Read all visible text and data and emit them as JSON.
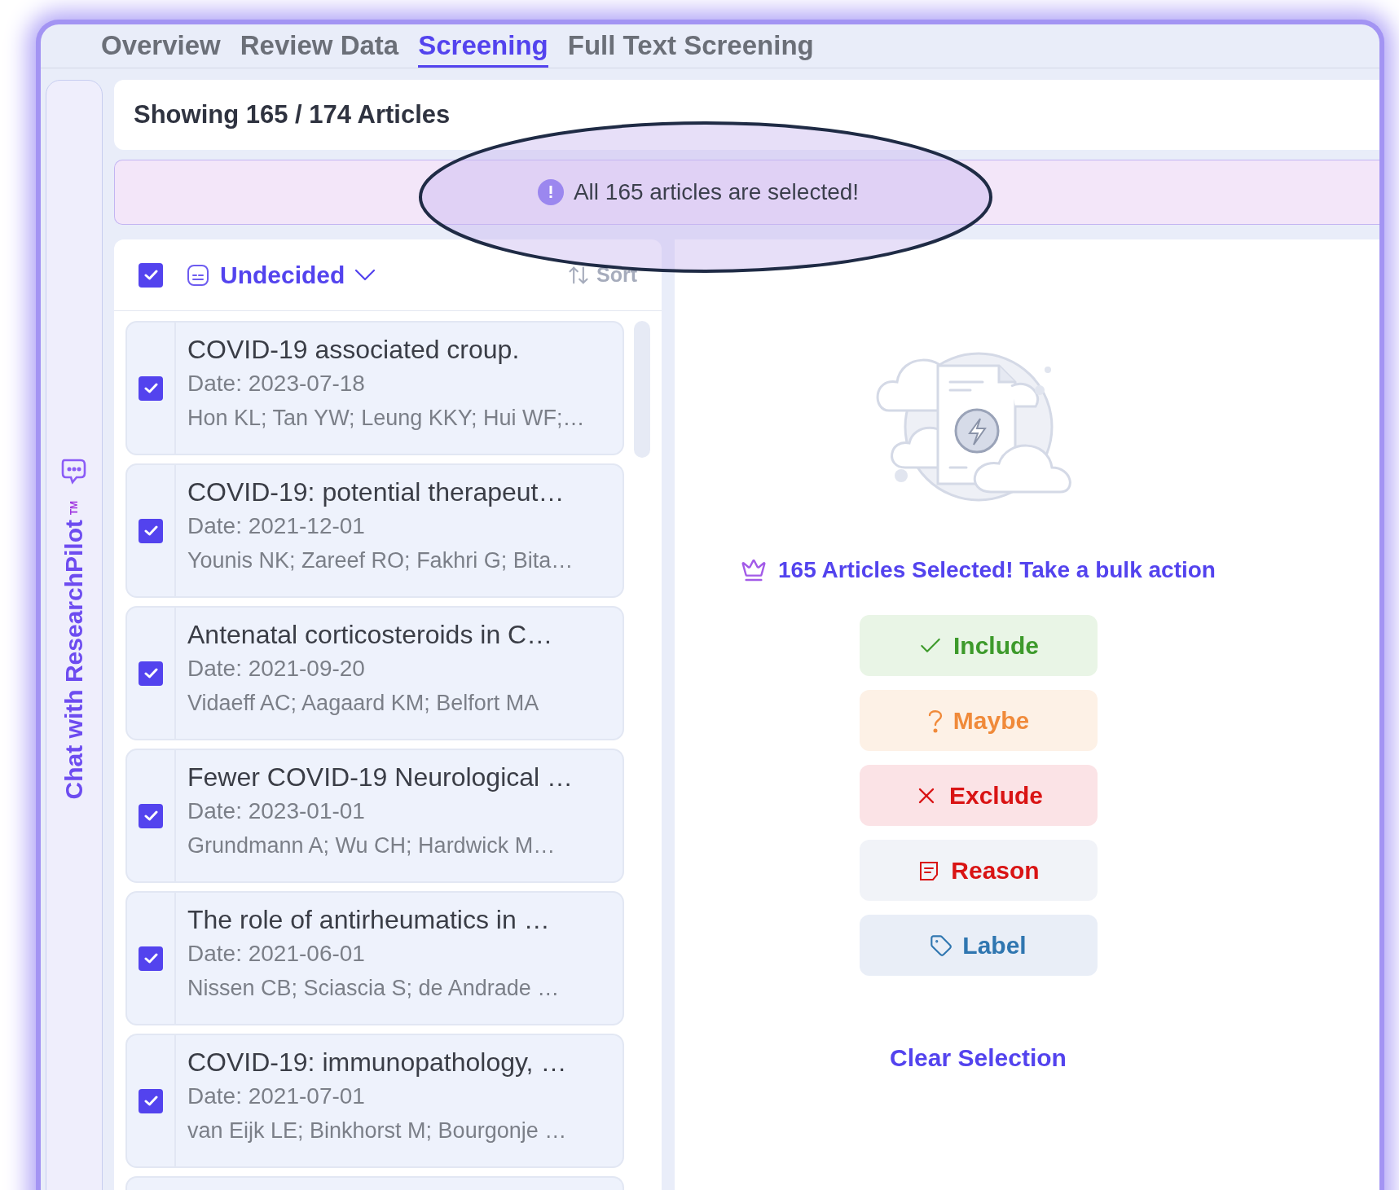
{
  "tabs": [
    {
      "label": "Overview",
      "selected": false
    },
    {
      "label": "Review Data",
      "selected": false
    },
    {
      "label": "Screening",
      "selected": true
    },
    {
      "label": "Full Text Screening",
      "selected": false
    }
  ],
  "sidebar": {
    "label": "Chat with ResearchPilot",
    "badge": "TM"
  },
  "header": {
    "title": "Showing 165 / 174 Articles"
  },
  "banner": {
    "message": "All 165 articles are selected!"
  },
  "list_header": {
    "select_all_checked": true,
    "filter": "Undecided",
    "sort": "Sort"
  },
  "articles": [
    {
      "checked": true,
      "title": "COVID-19 associated croup.",
      "date": "Date: 2023-07-18",
      "authors": "Hon KL; Tan YW; Leung KKY; Hui WF;…"
    },
    {
      "checked": true,
      "title": "COVID-19: potential therapeut…",
      "date": "Date: 2021-12-01",
      "authors": "Younis NK; Zareef RO; Fakhri G; Bita…"
    },
    {
      "checked": true,
      "title": "Antenatal corticosteroids in C…",
      "date": "Date: 2021-09-20",
      "authors": "Vidaeff AC; Aagaard KM; Belfort MA"
    },
    {
      "checked": true,
      "title": "Fewer COVID-19 Neurological …",
      "date": "Date: 2023-01-01",
      "authors": "Grundmann A; Wu CH; Hardwick M…"
    },
    {
      "checked": true,
      "title": "The role of antirheumatics in …",
      "date": "Date: 2021-06-01",
      "authors": "Nissen CB; Sciascia S; de Andrade …"
    },
    {
      "checked": true,
      "title": "COVID-19: immunopathology, …",
      "date": "Date: 2021-07-01",
      "authors": "van Eijk LE; Binkhorst M; Bourgonje …"
    }
  ],
  "bulk": {
    "message": "165 Articles Selected! Take a bulk action",
    "actions": [
      {
        "kind": "include",
        "label": "Include"
      },
      {
        "kind": "maybe",
        "label": "Maybe"
      },
      {
        "kind": "exclude",
        "label": "Exclude"
      },
      {
        "kind": "reason",
        "label": "Reason"
      },
      {
        "kind": "label",
        "label": "Label"
      }
    ],
    "clear": "Clear Selection"
  }
}
